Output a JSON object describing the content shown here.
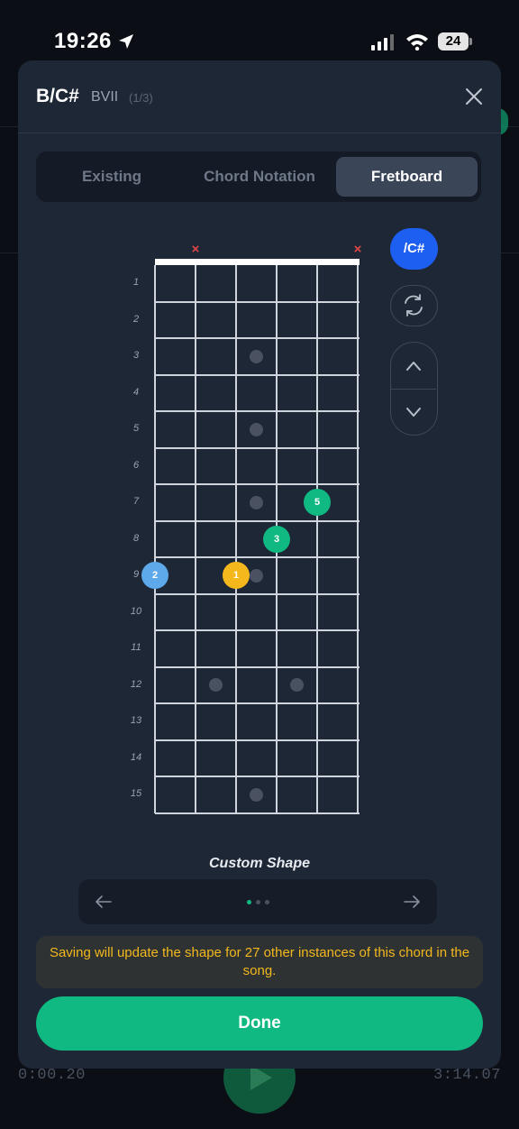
{
  "status_bar": {
    "time": "19:26",
    "battery": "24"
  },
  "background": {
    "elapsed": "0:00.20",
    "duration": "3:14.07"
  },
  "modal": {
    "chord_name": "B/C#",
    "position": "BVII",
    "count": "(1/3)",
    "tabs": [
      {
        "label": "Existing",
        "active": false
      },
      {
        "label": "Chord Notation",
        "active": false
      },
      {
        "label": "Fretboard",
        "active": true
      }
    ],
    "fretboard": {
      "fret_numbers": [
        "1",
        "2",
        "3",
        "4",
        "5",
        "6",
        "7",
        "8",
        "9",
        "10",
        "11",
        "12",
        "13",
        "14",
        "15"
      ],
      "muted_strings": [
        2,
        6
      ],
      "mute_symbol": "×",
      "fingers": [
        {
          "label": "2",
          "string": 1,
          "fret": 9,
          "color": "#5da9e9"
        },
        {
          "label": "1",
          "string": 3,
          "fret": 9,
          "color": "#f5b81c"
        },
        {
          "label": "3",
          "string": 4,
          "fret": 8,
          "color": "#10b981"
        },
        {
          "label": "5",
          "string": 5,
          "fret": 7,
          "color": "#10b981"
        }
      ]
    },
    "bass_button": "/C#",
    "shape_label": "Custom Shape",
    "shape_pages": {
      "current": 1,
      "total": 3
    },
    "notice": "Saving will update the shape for 27 other instances of this chord in the song.",
    "done_label": "Done"
  },
  "colors": {
    "accent_green": "#10b981",
    "accent_blue": "#1d5ff0",
    "warning": "#f2b81c",
    "mute": "#e04646"
  }
}
